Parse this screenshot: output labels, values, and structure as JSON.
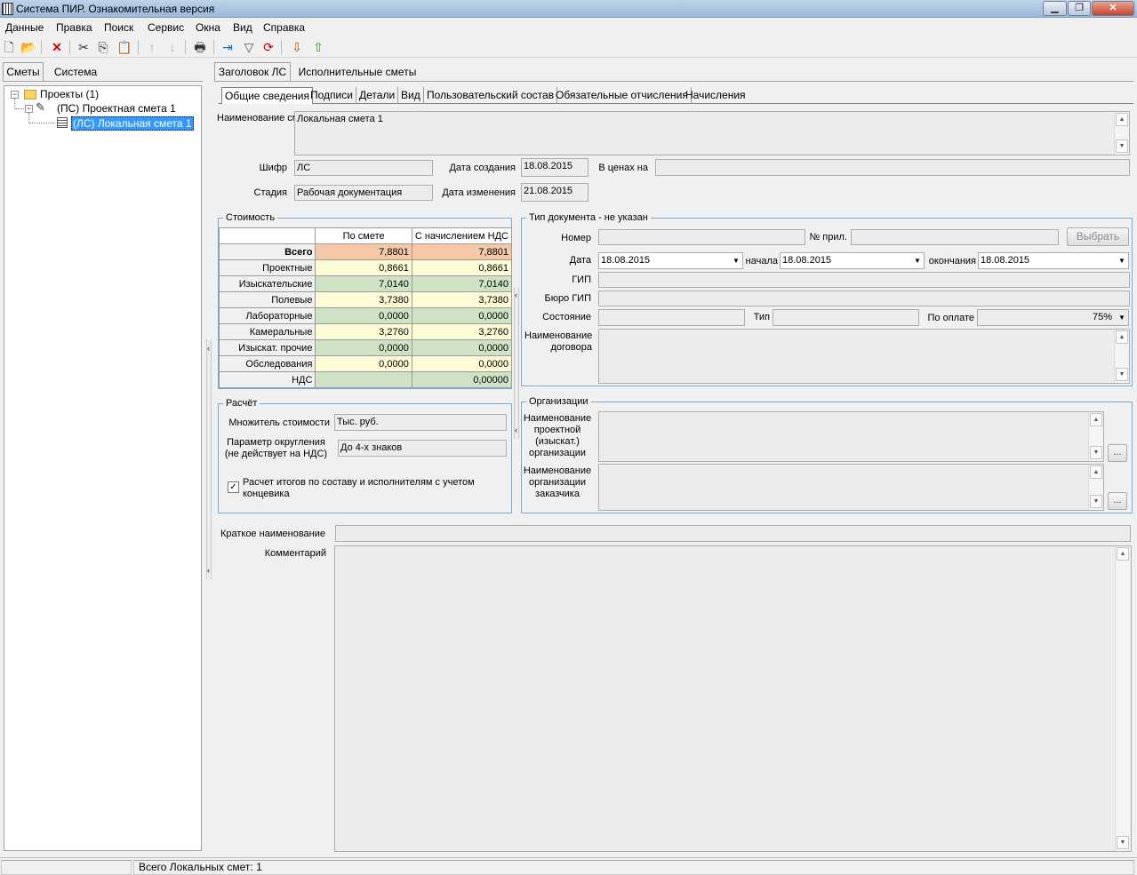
{
  "window": {
    "title": "Система ПИР. Ознакомительная версия"
  },
  "menu": [
    "Данные",
    "Правка",
    "Поиск",
    "Сервис",
    "Окна",
    "Вид",
    "Справка"
  ],
  "left_tabs": [
    "Сметы",
    "Система"
  ],
  "tree": {
    "root": "Проекты (1)",
    "child": "(ПС) Проектная смета 1",
    "grandchild": "(ЛС) Локальная смета 1"
  },
  "main_tabs": [
    "Заголовок ЛС",
    "Исполнительные сметы"
  ],
  "sub_tabs": [
    "Общие сведения",
    "Подписи",
    "Детали",
    "Вид",
    "Пользовательский состав",
    "Обязательные отчисления",
    "Начисления"
  ],
  "general": {
    "name_label": "Наименование сметы",
    "name_value": "Локальная смета 1",
    "cipher_label": "Шифр",
    "cipher_value": "ЛС",
    "stage_label": "Стадия",
    "stage_value": "Рабочая документация",
    "created_label": "Дата создания",
    "created_value": "18.08.2015",
    "modified_label": "Дата изменения",
    "modified_value": "21.08.2015",
    "prices_label": "В ценах на",
    "prices_value": ""
  },
  "cost": {
    "title": "Стоимость",
    "headers": [
      "",
      "По смете",
      "С начислением НДС"
    ],
    "rows": [
      {
        "label": "Всего",
        "a": "7,8801",
        "b": "7,8801"
      },
      {
        "label": "Проектные",
        "a": "0,8661",
        "b": "0,8661"
      },
      {
        "label": "Изыскательские",
        "a": "7,0140",
        "b": "7,0140"
      },
      {
        "label": "Полевые",
        "a": "3,7380",
        "b": "3,7380"
      },
      {
        "label": "Лабораторные",
        "a": "0,0000",
        "b": "0,0000"
      },
      {
        "label": "Камеральные",
        "a": "3,2760",
        "b": "3,2760"
      },
      {
        "label": "Изыскат. прочие",
        "a": "0,0000",
        "b": "0,0000"
      },
      {
        "label": "Обследования",
        "a": "0,0000",
        "b": "0,0000"
      },
      {
        "label": "НДС",
        "a": "",
        "b": "0,00000"
      }
    ],
    "colors": {
      "total": "#f4c8a6",
      "yellow": "#fdfbd6",
      "green": "#cfe2c6"
    }
  },
  "calc": {
    "title": "Расчёт",
    "multiplier_label": "Множитель стоимости",
    "multiplier_value": "Тыс. руб.",
    "round_label_1": "Параметр округления",
    "round_label_2": "(не действует на НДС)",
    "round_value": "До 4-х знаков",
    "checkbox_label_1": "Расчет итогов по составу и исполнителям с учетом",
    "checkbox_label_2": "концевика",
    "checkbox_mark": "✓"
  },
  "doc": {
    "title": "Тип документа - не указан",
    "number_label": "Номер",
    "appendix_label": "№ прил.",
    "choose_button": "Выбрать",
    "date_label": "Дата",
    "date_value": "18.08.2015",
    "start_label": "начала",
    "start_value": "18.08.2015",
    "end_label": "окончания",
    "end_value": "18.08.2015",
    "gip_label": "ГИП",
    "bureau_label": "Бюро ГИП",
    "state_label": "Состояние",
    "type_label": "Тип",
    "payment_label": "По оплате",
    "payment_value": "75%",
    "contract_label_1": "Наименование",
    "contract_label_2": "договора"
  },
  "orgs": {
    "title": "Организации",
    "design_label": [
      "Наименование",
      "проектной",
      "(изыскат.)",
      "организации"
    ],
    "customer_label": [
      "Наименование",
      "организации",
      "заказчика"
    ],
    "dots": "..."
  },
  "bottom": {
    "short_label": "Краткое наименование",
    "comment_label": "Комментарий"
  },
  "status": {
    "text": "Всего Локальных смет: 1"
  }
}
